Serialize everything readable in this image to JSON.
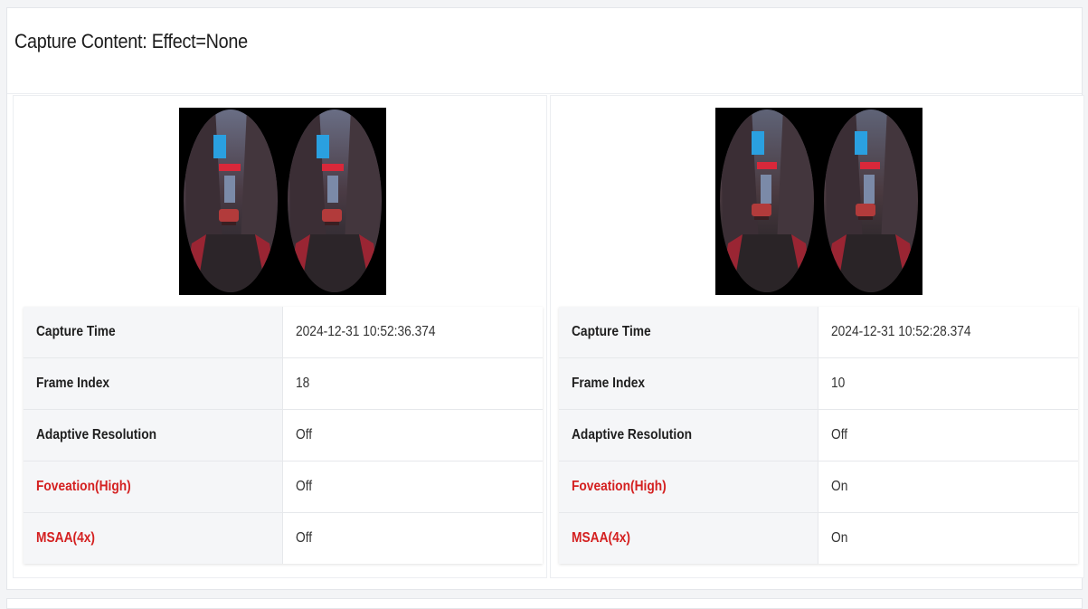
{
  "title": "Capture Content: Effect=None",
  "captures": [
    {
      "image_icon": "vr-stereo-capture-image",
      "rows": [
        {
          "label": "Capture Time",
          "value": "2024-12-31 10:52:36.374",
          "highlight": false
        },
        {
          "label": "Frame Index",
          "value": "18",
          "highlight": false
        },
        {
          "label": "Adaptive Resolution",
          "value": "Off",
          "highlight": false
        },
        {
          "label": "Foveation(High)",
          "value": "Off",
          "highlight": true
        },
        {
          "label": "MSAA(4x)",
          "value": "Off",
          "highlight": true
        }
      ]
    },
    {
      "image_icon": "vr-stereo-capture-image",
      "rows": [
        {
          "label": "Capture Time",
          "value": "2024-12-31 10:52:28.374",
          "highlight": false
        },
        {
          "label": "Frame Index",
          "value": "10",
          "highlight": false
        },
        {
          "label": "Adaptive Resolution",
          "value": "Off",
          "highlight": false
        },
        {
          "label": "Foveation(High)",
          "value": "On",
          "highlight": true
        },
        {
          "label": "MSAA(4x)",
          "value": "On",
          "highlight": true
        }
      ]
    }
  ],
  "colors": {
    "highlight_label": "#d42020",
    "key_cell_bg": "#f5f6f8",
    "page_bg": "#f3f4f6"
  }
}
